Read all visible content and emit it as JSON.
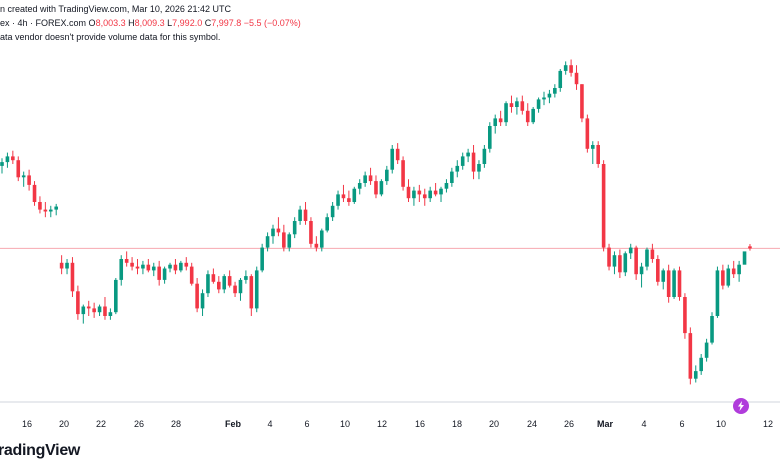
{
  "header": {
    "created_line": "n created with TradingView.com, Mar 10, 2026 21:42 UTC",
    "ticker": "ex · 4h · FOREX.com",
    "o_label": "O",
    "o_value": "8,003.3",
    "h_label": "H",
    "h_value": "8,009.3",
    "l_label": "L",
    "l_value": "7,992.0",
    "c_label": "C",
    "c_value": "7,997.8",
    "change": "−5.5 (−0.07%)",
    "volume_note": "ata vendor doesn't provide volume data for this symbol."
  },
  "brand": "radingView",
  "colors": {
    "up": "#089981",
    "down": "#f23645",
    "last_price_line": "#f7a8b0",
    "axis": "#d1d4dc"
  },
  "chart_data": {
    "type": "candlestick",
    "x_tick_labels": [
      "16",
      "20",
      "22",
      "26",
      "28",
      "Feb",
      "4",
      "6",
      "10",
      "12",
      "16",
      "18",
      "20",
      "24",
      "26",
      "Mar",
      "4",
      "6",
      "10",
      "12"
    ],
    "last_close": 7997.8,
    "candles": [
      [
        8215,
        8235,
        8195,
        8225
      ],
      [
        8225,
        8250,
        8210,
        8240
      ],
      [
        8240,
        8255,
        8220,
        8230
      ],
      [
        8230,
        8240,
        8175,
        8185
      ],
      [
        8185,
        8200,
        8160,
        8190
      ],
      [
        8190,
        8205,
        8150,
        8165
      ],
      [
        8165,
        8175,
        8110,
        8120
      ],
      [
        8120,
        8135,
        8090,
        8100
      ],
      [
        8100,
        8120,
        8080,
        8095
      ],
      [
        8095,
        8110,
        8080,
        8100
      ],
      [
        8100,
        8115,
        8085,
        8108
      ],
      [
        7960,
        7980,
        7930,
        7945
      ],
      [
        7945,
        7970,
        7930,
        7960
      ],
      [
        7960,
        7975,
        7870,
        7885
      ],
      [
        7885,
        7900,
        7810,
        7825
      ],
      [
        7825,
        7850,
        7800,
        7845
      ],
      [
        7845,
        7860,
        7820,
        7840
      ],
      [
        7840,
        7855,
        7815,
        7830
      ],
      [
        7830,
        7850,
        7820,
        7845
      ],
      [
        7845,
        7870,
        7810,
        7820
      ],
      [
        7820,
        7840,
        7810,
        7830
      ],
      [
        7830,
        7920,
        7825,
        7915
      ],
      [
        7915,
        7980,
        7900,
        7970
      ],
      [
        7970,
        7990,
        7950,
        7960
      ],
      [
        7960,
        7975,
        7940,
        7950
      ],
      [
        7950,
        7970,
        7930,
        7945
      ],
      [
        7945,
        7965,
        7930,
        7955
      ],
      [
        7955,
        7970,
        7935,
        7940
      ],
      [
        7940,
        7960,
        7925,
        7950
      ],
      [
        7950,
        7965,
        7900,
        7915
      ],
      [
        7915,
        7950,
        7905,
        7945
      ],
      [
        7945,
        7960,
        7935,
        7955
      ],
      [
        7955,
        7970,
        7930,
        7940
      ],
      [
        7940,
        7965,
        7935,
        7960
      ],
      [
        7960,
        7975,
        7940,
        7950
      ],
      [
        7950,
        7960,
        7900,
        7905
      ],
      [
        7905,
        7920,
        7830,
        7840
      ],
      [
        7840,
        7890,
        7820,
        7880
      ],
      [
        7880,
        7940,
        7870,
        7930
      ],
      [
        7930,
        7945,
        7905,
        7910
      ],
      [
        7910,
        7925,
        7880,
        7890
      ],
      [
        7890,
        7930,
        7880,
        7925
      ],
      [
        7925,
        7940,
        7895,
        7900
      ],
      [
        7900,
        7910,
        7870,
        7880
      ],
      [
        7880,
        7920,
        7860,
        7915
      ],
      [
        7915,
        7940,
        7905,
        7925
      ],
      [
        7925,
        7930,
        7820,
        7840
      ],
      [
        7840,
        7950,
        7830,
        7940
      ],
      [
        7940,
        8010,
        7935,
        8000
      ],
      [
        8000,
        8040,
        7990,
        8030
      ],
      [
        8030,
        8060,
        8010,
        8050
      ],
      [
        8050,
        8080,
        8030,
        8040
      ],
      [
        8040,
        8060,
        7990,
        8000
      ],
      [
        8000,
        8040,
        7990,
        8035
      ],
      [
        8035,
        8080,
        8025,
        8070
      ],
      [
        8070,
        8110,
        8060,
        8100
      ],
      [
        8100,
        8120,
        8060,
        8070
      ],
      [
        8070,
        8080,
        8000,
        8010
      ],
      [
        8010,
        8030,
        7990,
        8000
      ],
      [
        8000,
        8050,
        7990,
        8045
      ],
      [
        8045,
        8090,
        8040,
        8080
      ],
      [
        8080,
        8120,
        8070,
        8110
      ],
      [
        8110,
        8150,
        8100,
        8140
      ],
      [
        8140,
        8165,
        8120,
        8130
      ],
      [
        8130,
        8150,
        8110,
        8120
      ],
      [
        8120,
        8160,
        8115,
        8155
      ],
      [
        8155,
        8180,
        8140,
        8170
      ],
      [
        8170,
        8200,
        8160,
        8190
      ],
      [
        8190,
        8210,
        8165,
        8175
      ],
      [
        8175,
        8190,
        8130,
        8140
      ],
      [
        8140,
        8180,
        8135,
        8175
      ],
      [
        8175,
        8215,
        8165,
        8205
      ],
      [
        8205,
        8270,
        8195,
        8260
      ],
      [
        8260,
        8275,
        8220,
        8230
      ],
      [
        8230,
        8240,
        8150,
        8160
      ],
      [
        8160,
        8180,
        8120,
        8130
      ],
      [
        8130,
        8160,
        8110,
        8150
      ],
      [
        8150,
        8165,
        8120,
        8140
      ],
      [
        8140,
        8155,
        8110,
        8130
      ],
      [
        8130,
        8160,
        8120,
        8150
      ],
      [
        8150,
        8170,
        8135,
        8140
      ],
      [
        8140,
        8160,
        8120,
        8155
      ],
      [
        8155,
        8180,
        8145,
        8170
      ],
      [
        8170,
        8210,
        8160,
        8200
      ],
      [
        8200,
        8230,
        8185,
        8215
      ],
      [
        8215,
        8250,
        8205,
        8240
      ],
      [
        8240,
        8260,
        8225,
        8250
      ],
      [
        8250,
        8270,
        8180,
        8200
      ],
      [
        8200,
        8230,
        8180,
        8220
      ],
      [
        8220,
        8270,
        8210,
        8260
      ],
      [
        8260,
        8330,
        8250,
        8320
      ],
      [
        8320,
        8350,
        8300,
        8340
      ],
      [
        8340,
        8360,
        8320,
        8330
      ],
      [
        8330,
        8385,
        8320,
        8380
      ],
      [
        8380,
        8400,
        8355,
        8370
      ],
      [
        8370,
        8395,
        8350,
        8385
      ],
      [
        8385,
        8400,
        8350,
        8360
      ],
      [
        8360,
        8380,
        8320,
        8330
      ],
      [
        8330,
        8370,
        8325,
        8365
      ],
      [
        8365,
        8395,
        8355,
        8390
      ],
      [
        8390,
        8410,
        8375,
        8395
      ],
      [
        8395,
        8415,
        8380,
        8405
      ],
      [
        8405,
        8430,
        8395,
        8420
      ],
      [
        8420,
        8470,
        8410,
        8465
      ],
      [
        8465,
        8490,
        8455,
        8480
      ],
      [
        8480,
        8495,
        8450,
        8460
      ],
      [
        8460,
        8480,
        8415,
        8430
      ],
      [
        8430,
        8430,
        8330,
        8340
      ],
      [
        8340,
        8350,
        8250,
        8260
      ],
      [
        8260,
        8280,
        8220,
        8270
      ],
      [
        8270,
        8280,
        8210,
        8220
      ],
      [
        8220,
        8230,
        7990,
        8000
      ],
      [
        8000,
        8010,
        7940,
        7950
      ],
      [
        7950,
        7990,
        7930,
        7980
      ],
      [
        7980,
        7995,
        7920,
        7935
      ],
      [
        7935,
        7990,
        7925,
        7985
      ],
      [
        7985,
        8010,
        7970,
        8000
      ],
      [
        8000,
        8005,
        7915,
        7930
      ],
      [
        7930,
        7960,
        7895,
        7950
      ],
      [
        7950,
        8000,
        7940,
        7995
      ],
      [
        7995,
        8010,
        7960,
        7970
      ],
      [
        7970,
        7980,
        7900,
        7910
      ],
      [
        7910,
        7945,
        7890,
        7940
      ],
      [
        7940,
        7955,
        7855,
        7870
      ],
      [
        7870,
        7945,
        7865,
        7940
      ],
      [
        7940,
        7950,
        7860,
        7870
      ],
      [
        7870,
        7880,
        7760,
        7775
      ],
      [
        7775,
        7790,
        7640,
        7655
      ],
      [
        7655,
        7690,
        7645,
        7675
      ],
      [
        7675,
        7720,
        7665,
        7710
      ],
      [
        7710,
        7760,
        7700,
        7750
      ],
      [
        7750,
        7830,
        7745,
        7820
      ],
      [
        7820,
        7950,
        7815,
        7940
      ],
      [
        7940,
        7955,
        7890,
        7900
      ],
      [
        7900,
        7955,
        7895,
        7945
      ],
      [
        7945,
        7965,
        7920,
        7930
      ],
      [
        7930,
        7965,
        7910,
        7955
      ],
      [
        7955,
        7960,
        7985,
        7990
      ],
      [
        8003.3,
        8009.3,
        7992.0,
        7997.8
      ]
    ]
  }
}
